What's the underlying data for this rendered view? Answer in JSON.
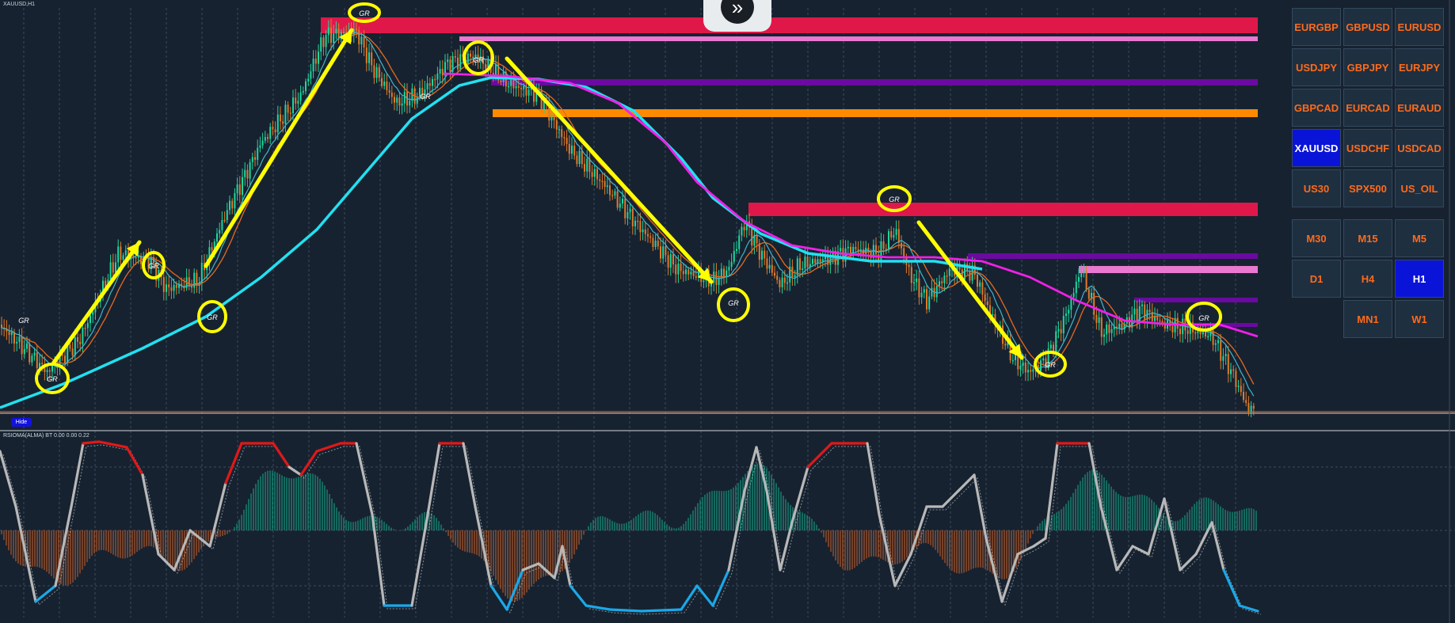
{
  "chart": {
    "title": "XAUUSD,H1",
    "hide_label": "Hide",
    "indicator_label": "RSIOMA(ALMA) BT 0.00 0.00 0.22",
    "signal_marker": "GR"
  },
  "symbols": [
    {
      "label": "EURGBP",
      "active": false
    },
    {
      "label": "GBPUSD",
      "active": false
    },
    {
      "label": "EURUSD",
      "active": false
    },
    {
      "label": "USDJPY",
      "active": false
    },
    {
      "label": "GBPJPY",
      "active": false
    },
    {
      "label": "EURJPY",
      "active": false
    },
    {
      "label": "GBPCAD",
      "active": false
    },
    {
      "label": "EURCAD",
      "active": false
    },
    {
      "label": "EURAUD",
      "active": false
    },
    {
      "label": "XAUUSD",
      "active": true
    },
    {
      "label": "USDCHF",
      "active": false
    },
    {
      "label": "USDCAD",
      "active": false
    },
    {
      "label": "US30",
      "active": false
    },
    {
      "label": "SPX500",
      "active": false
    },
    {
      "label": "US_OIL",
      "active": false
    }
  ],
  "timeframes": [
    {
      "label": "M30",
      "active": false
    },
    {
      "label": "M15",
      "active": false
    },
    {
      "label": "M5",
      "active": false
    },
    {
      "label": "D1",
      "active": false
    },
    {
      "label": "H4",
      "active": false
    },
    {
      "label": "H1",
      "active": true
    },
    {
      "label": "MN1",
      "active": false
    },
    {
      "label": "W1",
      "active": false
    }
  ],
  "colors": {
    "background": "#172230",
    "bull_candle": "#1fd6a0",
    "bear_candle": "#e07a2a",
    "slow_ma": "#22e0f0",
    "fast_ma": "#3fb7c8",
    "orange_ma": "#e86a20",
    "magenta_ma": "#f020e8",
    "annotation": "#ffff00",
    "zone_red": "#e0184a",
    "zone_pink": "#e878d0",
    "zone_purple": "#6a0aa0",
    "zone_orange": "#ff8a00",
    "button_active": "#0a14d8",
    "button_text": "#ff6a1a"
  },
  "icons": {
    "collapse_handle": "double-chevron-right-icon"
  }
}
